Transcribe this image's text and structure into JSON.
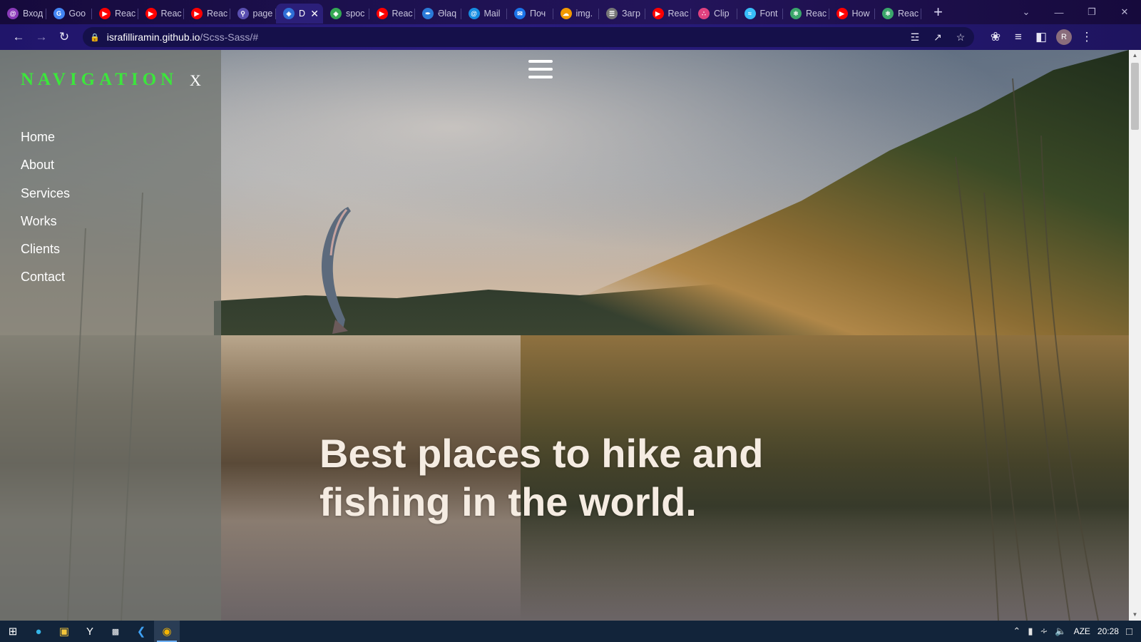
{
  "browser": {
    "tabs": [
      {
        "title": "Вход",
        "icon": "mail-icon",
        "color": "#8a3ab9"
      },
      {
        "title": "Goo",
        "icon": "translate-icon",
        "color": "#4285f4"
      },
      {
        "title": "Reac",
        "icon": "youtube-icon",
        "color": "#ff0000"
      },
      {
        "title": "Reac",
        "icon": "youtube-icon",
        "color": "#ff0000"
      },
      {
        "title": "Reac",
        "icon": "youtube-icon",
        "color": "#ff0000"
      },
      {
        "title": "page",
        "icon": "search-icon",
        "color": "#5a4fb0"
      },
      {
        "title": "D",
        "icon": "globe-icon",
        "color": "#2f6fd6",
        "active": true
      },
      {
        "title": "spoc",
        "icon": "globe-icon",
        "color": "#34a853"
      },
      {
        "title": "Reac",
        "icon": "youtube-icon",
        "color": "#ff0000"
      },
      {
        "title": "Əlaq",
        "icon": "feather-icon",
        "color": "#2a7ad8"
      },
      {
        "title": "Mail",
        "icon": "at-icon",
        "color": "#168de2"
      },
      {
        "title": "Поч",
        "icon": "envelope-icon",
        "color": "#1a73e8"
      },
      {
        "title": "img.",
        "icon": "cloud-icon",
        "color": "#f29900"
      },
      {
        "title": "Загр",
        "icon": "layers-icon",
        "color": "#777"
      },
      {
        "title": "Reac",
        "icon": "youtube-icon",
        "color": "#ff0000"
      },
      {
        "title": "Clip",
        "icon": "dots-icon",
        "color": "#e0417f"
      },
      {
        "title": "Font",
        "icon": "wave-icon",
        "color": "#38bdf8"
      },
      {
        "title": "Reac",
        "icon": "react-icon",
        "color": "#3aa66a"
      },
      {
        "title": "How",
        "icon": "youtube-icon",
        "color": "#ff0000"
      },
      {
        "title": "Reac",
        "icon": "react-icon",
        "color": "#3aa66a"
      }
    ],
    "url_host": "israfilliramin.github.io",
    "url_path": "/Scss-Sass/#",
    "profile_initial": "R"
  },
  "page": {
    "nav_title": "NAVIGATION",
    "nav_close": "X",
    "nav_items": [
      "Home",
      "About",
      "Services",
      "Works",
      "Clients",
      "Contact"
    ],
    "hero_title": "Best places to hike and fishing in the world.",
    "accent_color": "#3ce63c"
  },
  "taskbar": {
    "language": "AZE",
    "time": "20:28"
  }
}
